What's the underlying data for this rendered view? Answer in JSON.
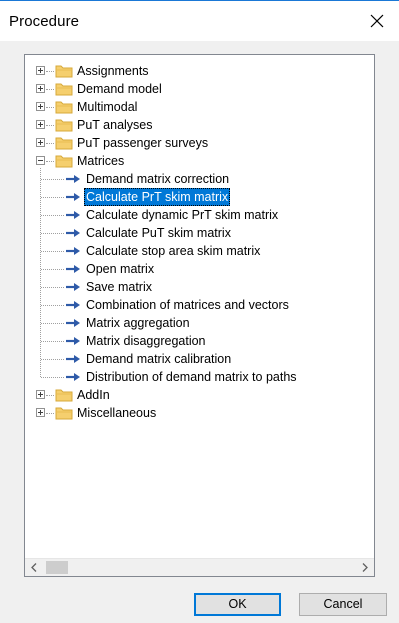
{
  "window": {
    "title": "Procedure"
  },
  "tree": {
    "nodes": [
      {
        "label": "Assignments",
        "type": "folder",
        "expanded": false
      },
      {
        "label": "Demand model",
        "type": "folder",
        "expanded": false
      },
      {
        "label": "Multimodal",
        "type": "folder",
        "expanded": false
      },
      {
        "label": "PuT analyses",
        "type": "folder",
        "expanded": false
      },
      {
        "label": "PuT passenger surveys",
        "type": "folder",
        "expanded": false
      },
      {
        "label": "Matrices",
        "type": "folder",
        "expanded": true,
        "children": [
          {
            "label": "Demand matrix correction"
          },
          {
            "label": "Calculate PrT skim matrix",
            "selected": true
          },
          {
            "label": "Calculate dynamic PrT skim matrix"
          },
          {
            "label": "Calculate PuT skim matrix"
          },
          {
            "label": "Calculate stop area skim matrix"
          },
          {
            "label": "Open matrix"
          },
          {
            "label": "Save matrix"
          },
          {
            "label": "Combination of matrices and vectors"
          },
          {
            "label": "Matrix aggregation"
          },
          {
            "label": "Matrix disaggregation"
          },
          {
            "label": "Demand matrix calibration"
          },
          {
            "label": "Distribution of demand matrix to paths"
          }
        ]
      },
      {
        "label": "AddIn",
        "type": "folder",
        "expanded": false
      },
      {
        "label": "Miscellaneous",
        "type": "folder",
        "expanded": false
      }
    ]
  },
  "buttons": {
    "ok": "OK",
    "cancel": "Cancel"
  },
  "icons": {
    "folder": "folder-icon",
    "procedure": "arrow-right-icon",
    "close": "close-icon",
    "scroll_left": "chevron-left-icon",
    "scroll_right": "chevron-right-icon"
  },
  "colors": {
    "selection": "#0078d7",
    "arrow": "#2e5aa8",
    "folder": "#f5cf6e",
    "default_button_border": "#0078d7",
    "title_accent": "#1a78d6"
  }
}
